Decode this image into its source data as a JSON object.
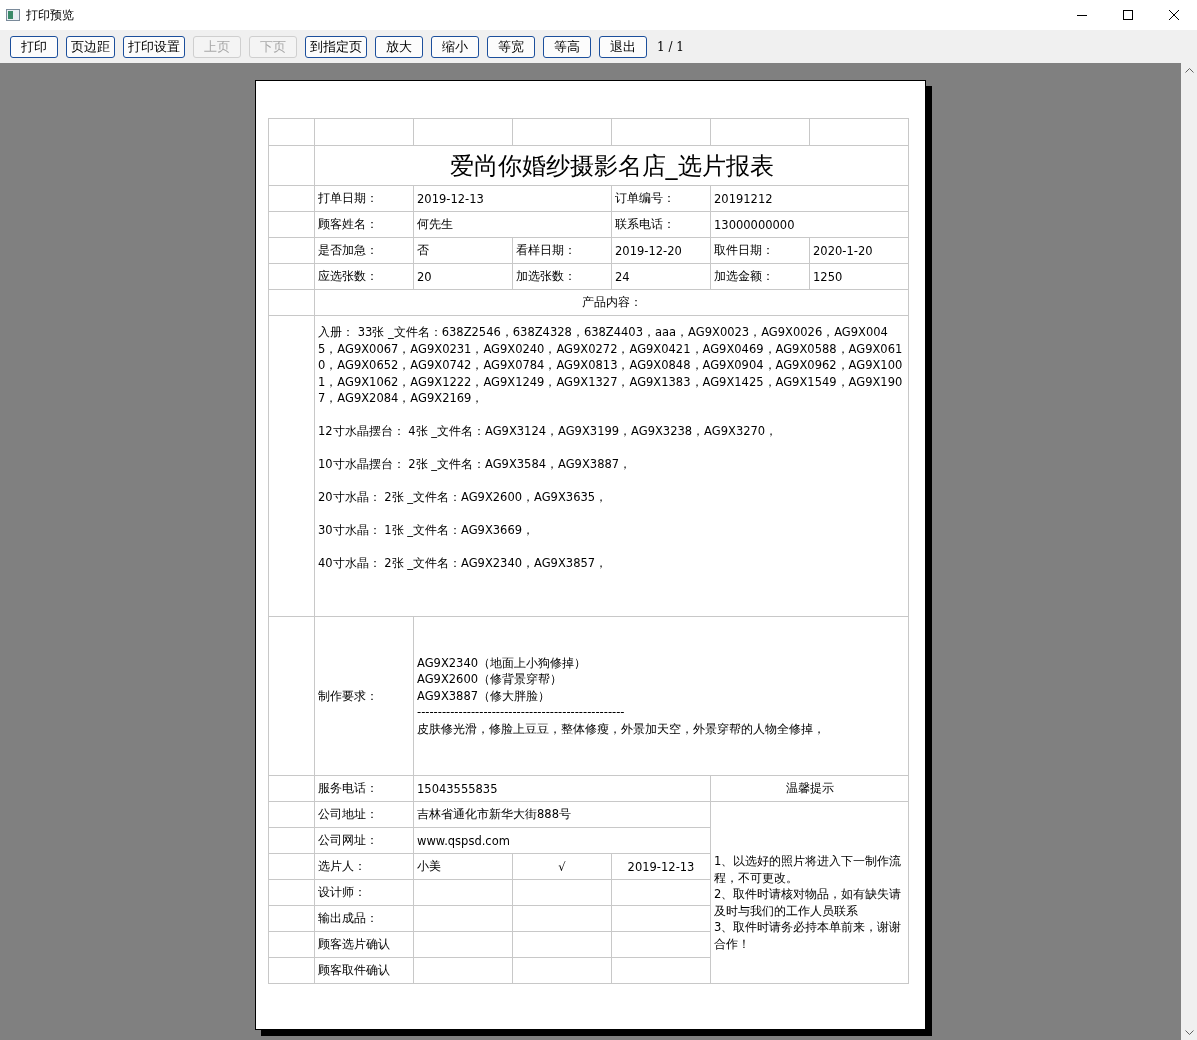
{
  "window": {
    "title": "打印预览"
  },
  "toolbar": {
    "buttons": [
      {
        "label": "打印",
        "disabled": false
      },
      {
        "label": "页边距",
        "disabled": false
      },
      {
        "label": "打印设置",
        "disabled": false
      },
      {
        "label": "上页",
        "disabled": true
      },
      {
        "label": "下页",
        "disabled": true
      },
      {
        "label": "到指定页",
        "disabled": false
      },
      {
        "label": "放大",
        "disabled": false
      },
      {
        "label": "缩小",
        "disabled": false
      },
      {
        "label": "等宽",
        "disabled": false
      },
      {
        "label": "等高",
        "disabled": false
      },
      {
        "label": "退出",
        "disabled": false
      }
    ],
    "page_indicator": "1 / 1"
  },
  "report": {
    "title": "爱尚你婚纱摄影名店_选片报表",
    "info_rows": [
      {
        "kind": "pairs",
        "cells": [
          "打单日期：",
          "2019-12-13",
          "订单编号：",
          "20191212"
        ]
      },
      {
        "kind": "pairs",
        "cells": [
          "顾客姓名：",
          "何先生",
          "联系电话：",
          "13000000000"
        ]
      },
      {
        "kind": "triples",
        "cells": [
          "是否加急：",
          "否",
          "看样日期：",
          "2019-12-20",
          "取件日期：",
          "2020-1-20"
        ]
      },
      {
        "kind": "triples",
        "cells": [
          "应选张数：",
          "20",
          "加选张数：",
          "24",
          "加选金额：",
          "1250"
        ]
      }
    ],
    "product_heading": "产品内容：",
    "product_lines": [
      "入册： 33张 _文件名：638Z2546，638Z4328，638Z4403，aaa，AG9X0023，AG9X0026，AG9X0045，AG9X0067，AG9X0231，AG9X0240，AG9X0272，AG9X0421，AG9X0469，AG9X0588，AG9X0610，AG9X0652，AG9X0742，AG9X0784，AG9X0813，AG9X0848，AG9X0904，AG9X0962，AG9X1001，AG9X1062，AG9X1222，AG9X1249，AG9X1327，AG9X1383，AG9X1425，AG9X1549，AG9X1907，AG9X2084，AG9X2169，",
      "12寸水晶摆台： 4张 _文件名：AG9X3124，AG9X3199，AG9X3238，AG9X3270，",
      "10寸水晶摆台： 2张 _文件名：AG9X3584，AG9X3887，",
      "20寸水晶： 2张 _文件名：AG9X2600，AG9X3635，",
      "30寸水晶： 1张 _文件名：AG9X3669，",
      "40寸水晶： 2张 _文件名：AG9X2340，AG9X3857，"
    ],
    "requirements": {
      "label": "制作要求：",
      "lines": [
        "AG9X2340（地面上小狗修掉）",
        "AG9X2600（修背景穿帮）",
        "AG9X3887（修大胖脸）",
        "--------------------------------------------------",
        "皮肤修光滑，修脸上豆豆，整体修瘦，外景加天空，外景穿帮的人物全修掉，"
      ]
    },
    "service_phone": {
      "label": "服务电话：",
      "value": "15043555835"
    },
    "notice": {
      "heading": "温馨提示",
      "items": [
        "1、以选好的照片将进入下一制作流程，不可更改。",
        "2、取件时请核对物品，如有缺失请及时与我们的工作人员联系",
        "3、取件时请务必持本单前来，谢谢合作！"
      ]
    },
    "company_rows": [
      {
        "label": "公司地址：",
        "value": "吉林省通化市新华大街888号"
      },
      {
        "label": "公司网址：",
        "value": "www.qspsd.com"
      }
    ],
    "sign_rows": [
      {
        "label": "选片人：",
        "cells": [
          "小美",
          "√",
          "2019-12-13"
        ]
      },
      {
        "label": "设计师：",
        "cells": []
      },
      {
        "label": "输出成品：",
        "cells": []
      },
      {
        "label": "顾客选片确认",
        "cells": []
      },
      {
        "label": "顾客取件确认",
        "cells": []
      }
    ]
  }
}
